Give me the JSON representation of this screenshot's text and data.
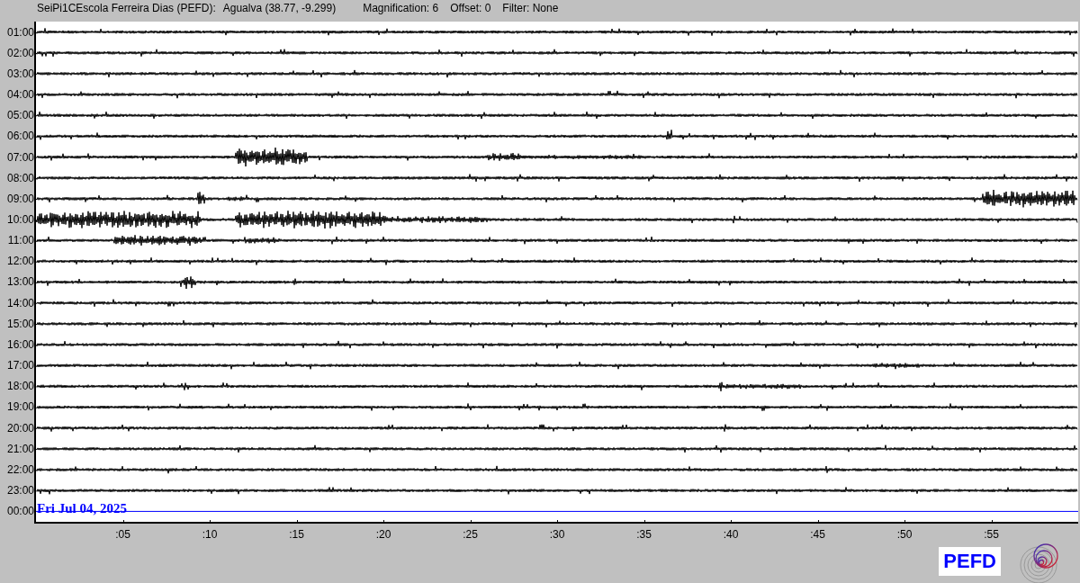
{
  "header": {
    "station": "SeiPi1CEscola Ferreira Dias (PEFD):",
    "location": "Agualva (38.77, -9.299)",
    "magnification": "Magnification: 6",
    "offset": "Offset: 0",
    "filter": "Filter: None"
  },
  "rows": [
    {
      "hour": "01:00",
      "kind": "recorded"
    },
    {
      "hour": "02:00",
      "kind": "recorded"
    },
    {
      "hour": "03:00",
      "kind": "recorded"
    },
    {
      "hour": "04:00",
      "kind": "recorded"
    },
    {
      "hour": "05:00",
      "kind": "recorded"
    },
    {
      "hour": "06:00",
      "kind": "recorded"
    },
    {
      "hour": "07:00",
      "kind": "recorded"
    },
    {
      "hour": "08:00",
      "kind": "recorded"
    },
    {
      "hour": "09:00",
      "kind": "recorded"
    },
    {
      "hour": "10:00",
      "kind": "recorded"
    },
    {
      "hour": "11:00",
      "kind": "recorded"
    },
    {
      "hour": "12:00",
      "kind": "recorded"
    },
    {
      "hour": "13:00",
      "kind": "recorded"
    },
    {
      "hour": "14:00",
      "kind": "recorded"
    },
    {
      "hour": "15:00",
      "kind": "recorded"
    },
    {
      "hour": "16:00",
      "kind": "recorded"
    },
    {
      "hour": "17:00",
      "kind": "recorded"
    },
    {
      "hour": "18:00",
      "kind": "recorded"
    },
    {
      "hour": "19:00",
      "kind": "recorded"
    },
    {
      "hour": "20:00",
      "kind": "recorded"
    },
    {
      "hour": "21:00",
      "kind": "recorded"
    },
    {
      "hour": "22:00",
      "kind": "recorded"
    },
    {
      "hour": "23:00",
      "kind": "recorded"
    },
    {
      "hour": "00:00",
      "kind": "current"
    }
  ],
  "date_label": "Fri Jul 04, 2025",
  "x_axis_labels": [
    ":05",
    ":10",
    ":15",
    ":20",
    ":25",
    ":30",
    ":35",
    ":40",
    ":45",
    ":50",
    ":55"
  ],
  "station_code": "PEFD"
}
